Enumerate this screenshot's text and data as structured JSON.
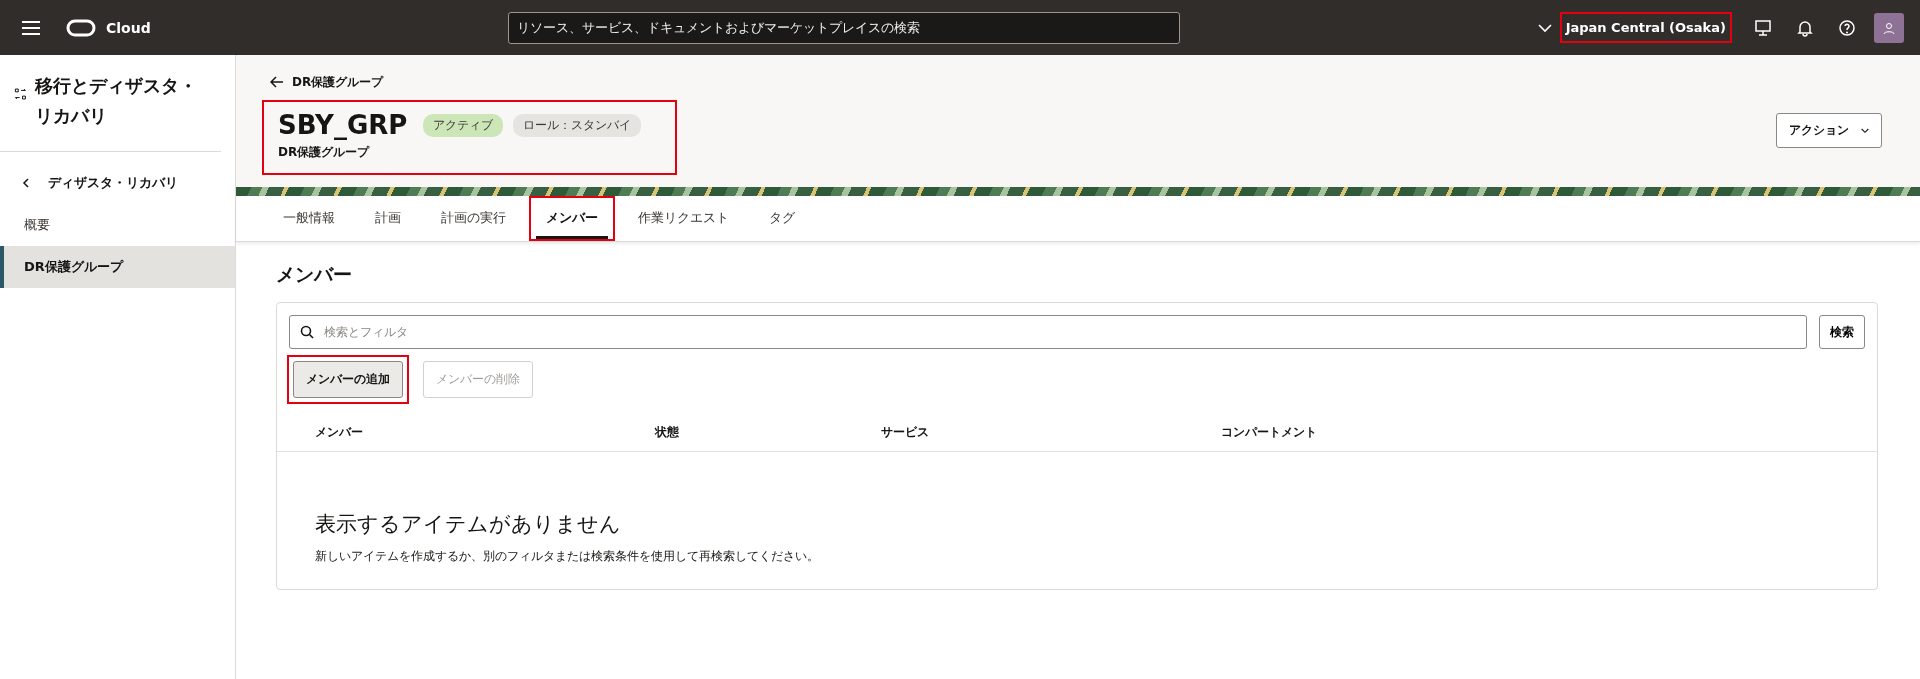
{
  "topbar": {
    "brand": "Cloud",
    "search_placeholder": "リソース、サービス、ドキュメントおよびマーケットプレイスの検索",
    "region": "Japan Central (Osaka)",
    "region_highlighted": true
  },
  "sidebar": {
    "title": "移行とディザスタ・リカバリ",
    "back_link": "ディザスタ・リカバリ",
    "items": [
      {
        "label": "概要",
        "selected": false
      },
      {
        "label": "DR保護グループ",
        "selected": true
      }
    ]
  },
  "header": {
    "breadcrumb": "DR保護グループ",
    "title": "SBY_GRP",
    "subtitle": "DR保護グループ",
    "highlighted": true,
    "badges": [
      {
        "label": "アクティブ",
        "color": "#cde6b8"
      },
      {
        "label": "ロール：スタンバイ",
        "color": "#e6e4e1"
      }
    ],
    "actions_button": "アクション"
  },
  "tabs": [
    {
      "label": "一般情報",
      "selected": false,
      "highlighted": false
    },
    {
      "label": "計画",
      "selected": false,
      "highlighted": false
    },
    {
      "label": "計画の実行",
      "selected": false,
      "highlighted": false
    },
    {
      "label": "メンバー",
      "selected": true,
      "highlighted": true
    },
    {
      "label": "作業リクエスト",
      "selected": false,
      "highlighted": false
    },
    {
      "label": "タグ",
      "selected": false,
      "highlighted": false
    }
  ],
  "section": {
    "title": "メンバー",
    "search_placeholder": "検索とフィルタ",
    "search_button": "検索",
    "buttons": [
      {
        "label": "メンバーの追加",
        "disabled": false,
        "highlighted": true
      },
      {
        "label": "メンバーの削除",
        "disabled": true,
        "highlighted": false
      }
    ],
    "table": {
      "columns": [
        "メンバー",
        "状態",
        "サービス",
        "コンパートメント"
      ],
      "empty_title": "表示するアイテムがありません",
      "empty_message": "新しいアイテムを作成するか、別のフィルタまたは検索条件を使用して再検索してください。"
    }
  }
}
